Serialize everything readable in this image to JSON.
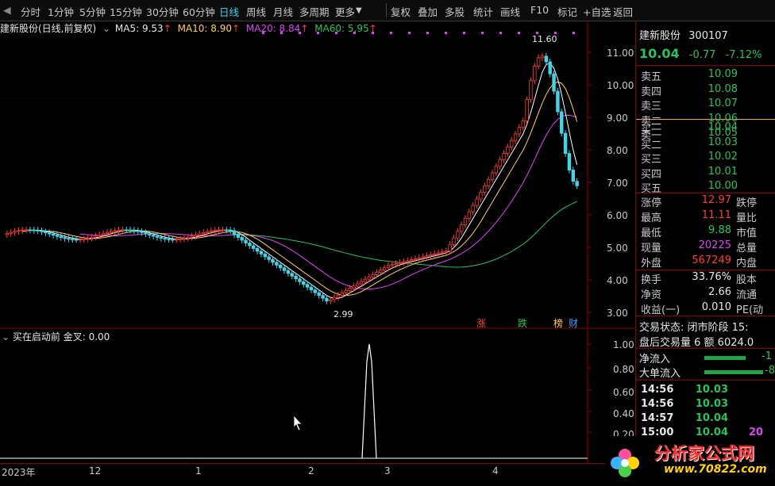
{
  "toolbar": {
    "left_items": [
      "分时",
      "1分钟",
      "5分钟",
      "15分钟",
      "30分钟",
      "60分钟",
      "日线",
      "周线",
      "月线",
      "多周期",
      "更多"
    ],
    "active": "日线",
    "right_items": [
      "复权",
      "叠加",
      "多股",
      "统计",
      "画线",
      "F10",
      "标记",
      "+自选",
      "返回"
    ]
  },
  "chart_header": {
    "title": "建新股份(日线,前复权)",
    "ma5": "MA5: 9.53",
    "ma10": "MA10: 8.90",
    "ma20": "MA20: 8.84",
    "ma60": "MA60: 5.95"
  },
  "price_axis": [
    "11.00",
    "10.00",
    "9.00",
    "8.00",
    "7.00",
    "6.00",
    "5.00",
    "4.00",
    "3.00"
  ],
  "annotations": {
    "high": "11.60",
    "low": "2.99"
  },
  "event_markers": [
    "涨",
    "跌",
    "榜",
    "财"
  ],
  "indicator_panel": {
    "title": "买在启动前 金叉: 0.00",
    "axis": [
      "1.00",
      "0.80",
      "0.60",
      "0.40",
      "0.20"
    ]
  },
  "time_axis": [
    "2023年",
    "12",
    "1",
    "2",
    "3",
    "4"
  ],
  "stock": {
    "name": "建新股份",
    "code": "300107",
    "price": "10.04",
    "change": "-0.77",
    "pct": "-7.12%"
  },
  "order_book": {
    "asks": [
      {
        "label": "卖五",
        "price": "10.09"
      },
      {
        "label": "卖四",
        "price": "10.08"
      },
      {
        "label": "卖三",
        "price": "10.07"
      },
      {
        "label": "卖二",
        "price": "10.06"
      },
      {
        "label": "卖一",
        "price": "10.05"
      }
    ],
    "bids": [
      {
        "label": "买一",
        "price": "10.04"
      },
      {
        "label": "买二",
        "price": "10.03"
      },
      {
        "label": "买三",
        "price": "10.02"
      },
      {
        "label": "买四",
        "price": "10.01"
      },
      {
        "label": "买五",
        "price": "10.00"
      }
    ]
  },
  "stats": [
    {
      "label": "涨停",
      "value": "12.97",
      "extra": "跌停"
    },
    {
      "label": "最高",
      "value": "11.11",
      "extra": "量比"
    },
    {
      "label": "最低",
      "value": "9.88",
      "extra": "市值"
    },
    {
      "label": "现量",
      "value": "20225",
      "extra": "总量"
    },
    {
      "label": "外盘",
      "value": "567249",
      "extra": "内盘"
    }
  ],
  "stats2": [
    {
      "label": "换手",
      "value": "33.76%",
      "extra": "股本"
    },
    {
      "label": "净资",
      "value": "2.66",
      "extra": "流通"
    },
    {
      "label": "收益(一)",
      "value": "0.010",
      "extra": "PE(动"
    }
  ],
  "trade_status": {
    "line1": "交易状态: 闭市阶段 15:",
    "line2": "盘后交易量 6 额 6024.0"
  },
  "flows": [
    {
      "label": "净流入",
      "value": "-1"
    },
    {
      "label": "大单流入",
      "value": "-8"
    }
  ],
  "ticks": [
    {
      "time": "14:56",
      "price": "10.03",
      "vol": ""
    },
    {
      "time": "14:56",
      "price": "10.03",
      "vol": ""
    },
    {
      "time": "14:57",
      "price": "10.04",
      "vol": ""
    },
    {
      "time": "15:00",
      "price": "10.04",
      "vol": "20"
    }
  ],
  "watermark": {
    "text": "分析家公式网",
    "url": "www.70822.com"
  }
}
